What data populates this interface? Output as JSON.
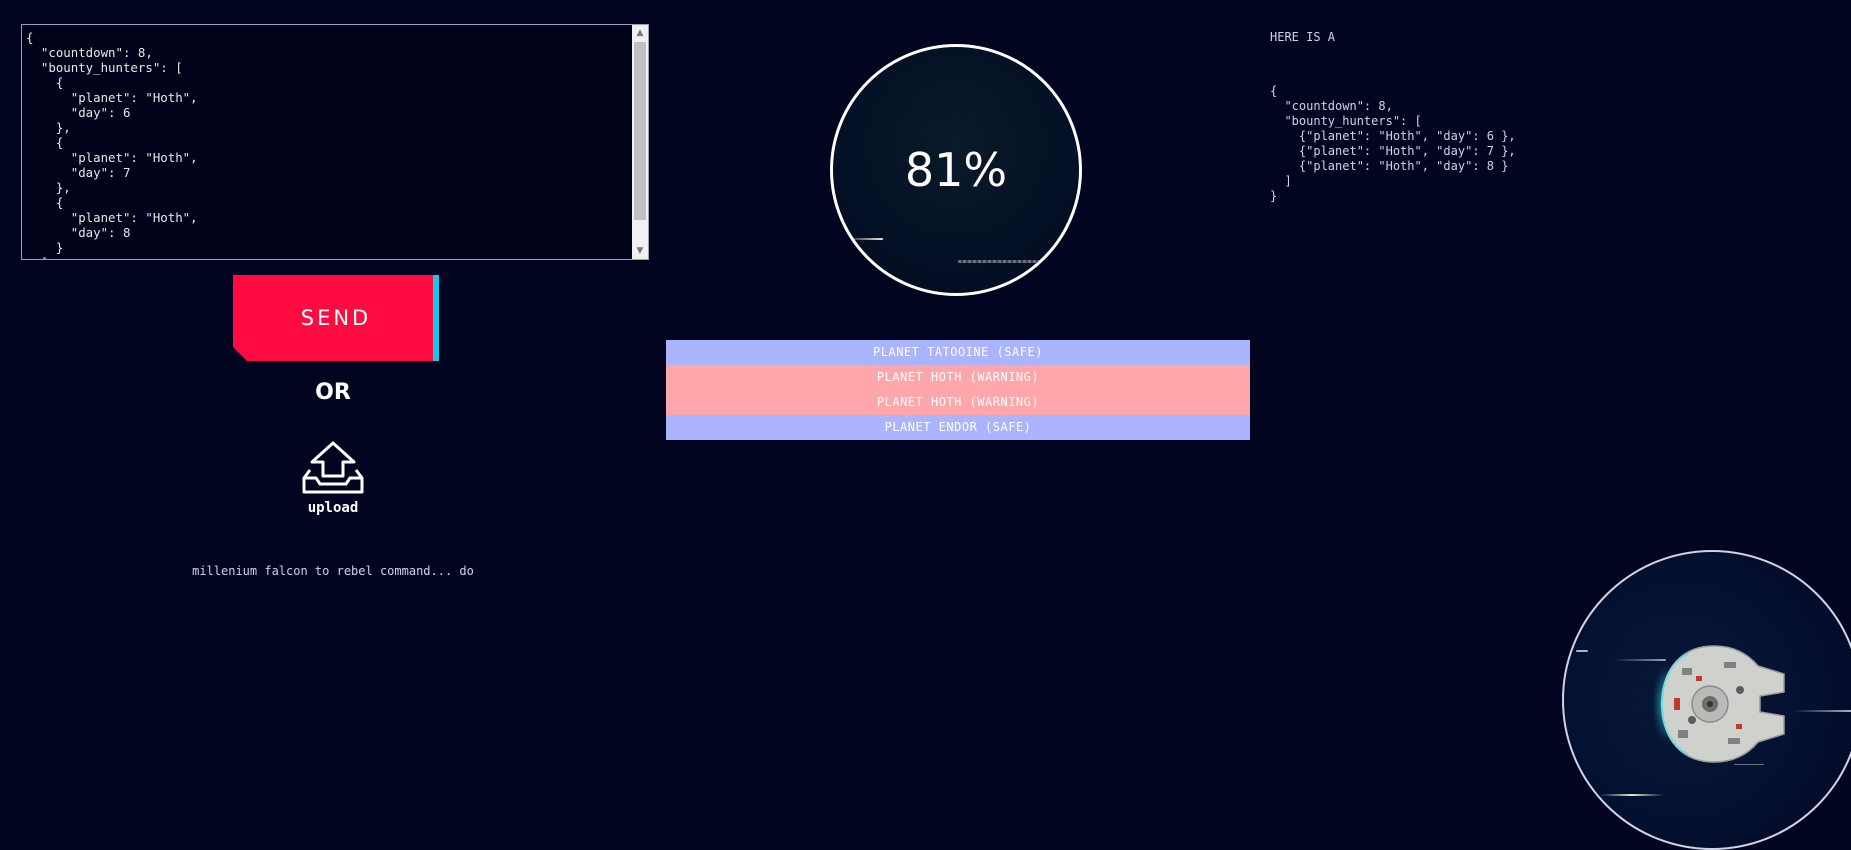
{
  "editor": {
    "content": "{\n  \"countdown\": 8,\n  \"bounty_hunters\": [\n    {\n      \"planet\": \"Hoth\",\n      \"day\": 6\n    },\n    {\n      \"planet\": \"Hoth\",\n      \"day\": 7\n    },\n    {\n      \"planet\": \"Hoth\",\n      \"day\": 8\n    }\n  ]\n}"
  },
  "send_label": "SEND",
  "or_label": "OR",
  "upload_label": "upload",
  "status_text": "millenium falcon to rebel command... do",
  "progress": {
    "value": 81,
    "label": "81%"
  },
  "planets": [
    {
      "label": "PLANET TATOOINE (SAFE)",
      "status": "safe"
    },
    {
      "label": "PLANET HOTH (WARNING)",
      "status": "warning"
    },
    {
      "label": "PLANET HOTH (WARNING)",
      "status": "warning"
    },
    {
      "label": "PLANET ENDOR (SAFE)",
      "status": "safe"
    }
  ],
  "output": {
    "heading": "HERE IS A",
    "json": "{\n  \"countdown\": 8,\n  \"bounty_hunters\": [\n    {\"planet\": \"Hoth\", \"day\": 6 },\n    {\"planet\": \"Hoth\", \"day\": 7 },\n    {\"planet\": \"Hoth\", \"day\": 8 }\n  ]\n}"
  },
  "colors": {
    "background": "#020520",
    "send": "#ff0b42",
    "send_accent": "#19c6e6",
    "safe": "#aab4ff",
    "warning": "#ffa6aa"
  },
  "icons": {
    "upload": "upload-icon",
    "ship": "millennium-falcon-icon"
  }
}
